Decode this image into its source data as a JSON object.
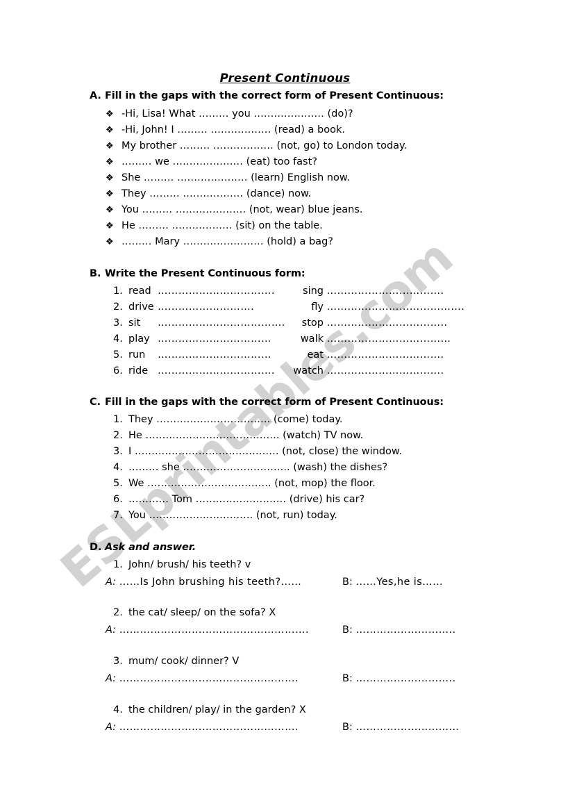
{
  "watermark": {
    "text": "ESLprintables.com",
    "color": "#d2d2d2"
  },
  "title": "Present Continuous",
  "sections": {
    "a": {
      "letter": "A.",
      "heading": "Fill in the gaps with the correct form of Present Continuous:",
      "bullet_glyph": "❖",
      "items": [
        "-Hi, Lisa! What ……… you ………………… (do)?",
        "-Hi, John! I ……… ……………… (read) a book.",
        "My brother ……… ……………… (not, go) to London today.",
        "……… we ………………… (eat) too fast?",
        "She ……… ………………… (learn) English now.",
        "They ……… ……………… (dance) now.",
        "You ……… ………………… (not, wear) blue jeans.",
        "He ……… ……………… (sit) on the table.",
        "……… Mary …………………… (hold) a bag?"
      ]
    },
    "b": {
      "letter": "B.",
      "heading": "Write the Present Continuous form:",
      "rows": [
        {
          "num": "1.",
          "left_verb": "read",
          "left_dots": "…………………………….",
          "right_verb": "sing",
          "right_dots": "……………………………."
        },
        {
          "num": "2.",
          "left_verb": "drive",
          "left_dots": "……………………….",
          "right_verb": "fly",
          "right_dots": "…………………………………."
        },
        {
          "num": "3.",
          "left_verb": "sit",
          "left_dots": "……………………………….",
          "right_verb": "stop",
          "right_dots": "…………………………….."
        },
        {
          "num": "4.",
          "left_verb": "play",
          "left_dots": "……………………………",
          "right_verb": "walk",
          "right_dots": "………………………………"
        },
        {
          "num": "5.",
          "left_verb": "run",
          "left_dots": "……………………………",
          "right_verb": "eat",
          "right_dots": "……………………………."
        },
        {
          "num": "6.",
          "left_verb": "ride",
          "left_dots": "…………………………….",
          "right_verb": "watch",
          "right_dots": "……………………………."
        }
      ]
    },
    "c": {
      "letter": "C.",
      "heading": "Fill in the gaps with the correct form of Present Continuous:",
      "items": [
        {
          "num": "1.",
          "text": "They ……………………………. (come) today."
        },
        {
          "num": "2.",
          "text": "He …………………………………. (watch) TV now."
        },
        {
          "num": "3.",
          "text": "I ……………………………………. (not, close) the window."
        },
        {
          "num": "4.",
          "text": "……… she ………………………….. (wash) the dishes?"
        },
        {
          "num": "5.",
          "text": "We ………………………………. (not, mop) the floor."
        },
        {
          "num": "6.",
          "text": "………… Tom ……………………… (drive) his car?"
        },
        {
          "num": "7.",
          "text": "You …………………………. (not, run) today."
        }
      ]
    },
    "d": {
      "letter": "D.",
      "heading": "Ask and answer.",
      "items": [
        {
          "num": "1.",
          "prompt": "John/ brush/ his teeth?   v",
          "a_label": "A:",
          "a_text": "……Is John brushing his teeth?……",
          "b_label": "B:",
          "b_text": "……Yes,he is……"
        },
        {
          "num": "2.",
          "prompt": "the cat/ sleep/ on the sofa? X",
          "a_label": "A:",
          "a_text": "……………………………………………….",
          "b_label": "B:",
          "b_text": "……………………….."
        },
        {
          "num": "3.",
          "prompt": "mum/ cook/ dinner?  V",
          "a_label": "A:",
          "a_text": "…………………………………………….",
          "b_label": "B:",
          "b_text": "……………………….."
        },
        {
          "num": "4.",
          "prompt": "the children/ play/ in the garden? X",
          "a_label": "A:",
          "a_text": "…………………………………………….",
          "b_label": "B:",
          "b_text": "…………………………"
        }
      ]
    }
  }
}
